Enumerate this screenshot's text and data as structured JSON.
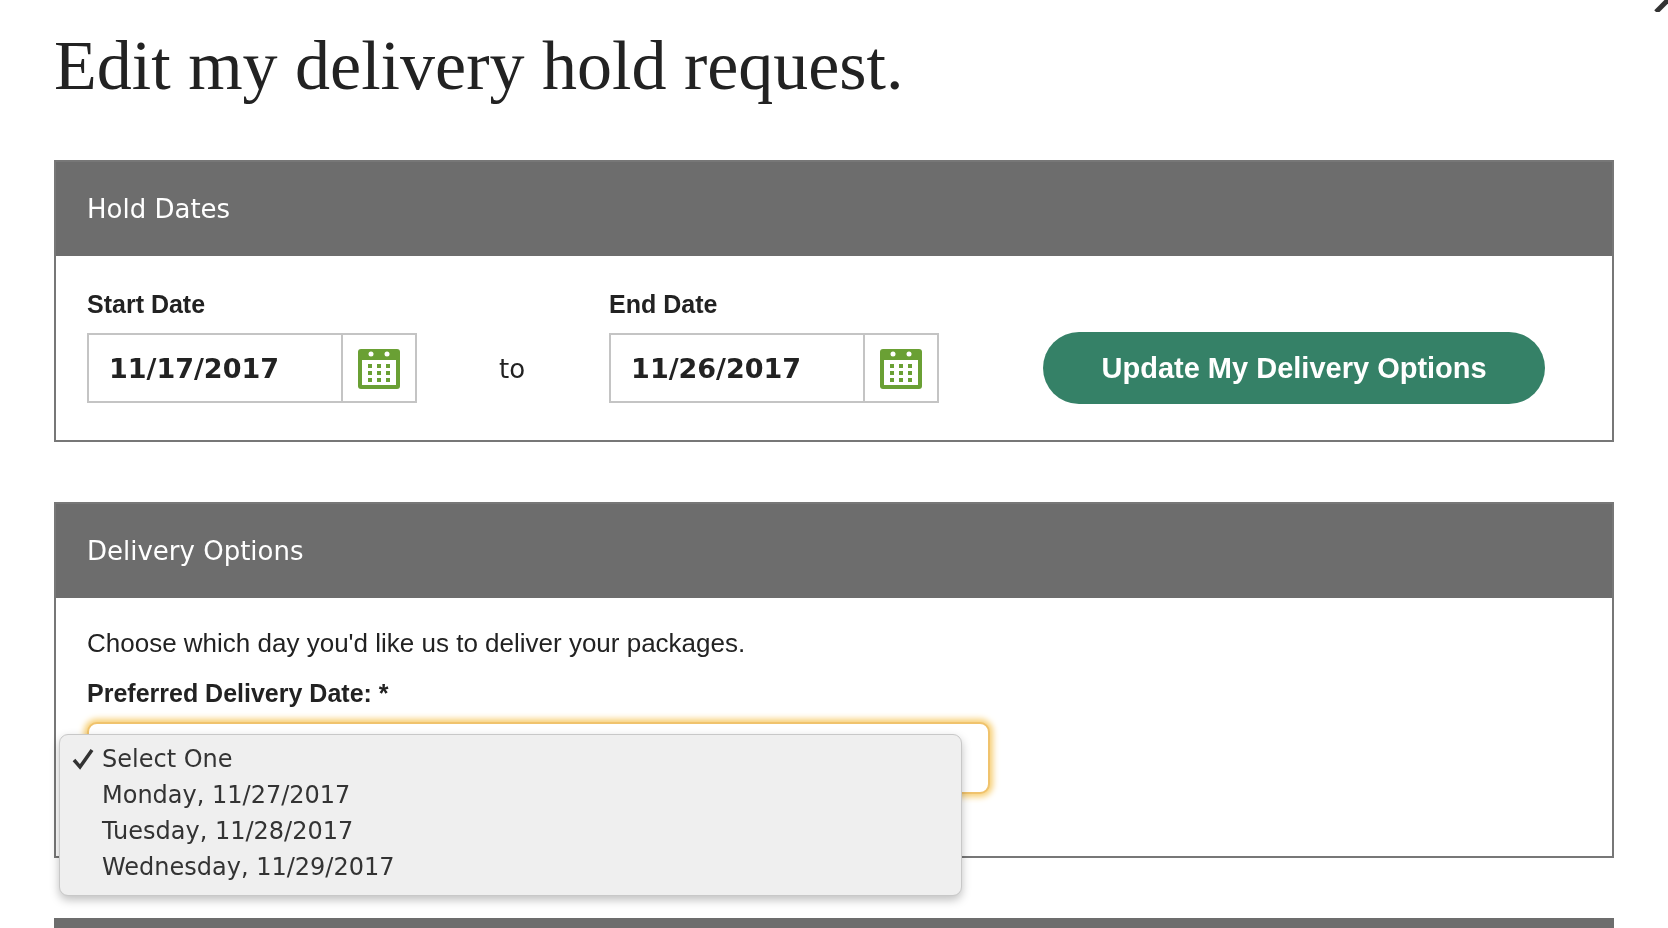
{
  "title": "Edit my delivery hold request.",
  "hold_dates": {
    "heading": "Hold Dates",
    "start": {
      "label": "Start Date",
      "value": "11/17/2017"
    },
    "separator": "to",
    "end": {
      "label": "End Date",
      "value": "11/26/2017"
    },
    "button": "Update My Delivery Options"
  },
  "delivery_options": {
    "heading": "Delivery Options",
    "intro": "Choose which day you'd like us to deliver your packages.",
    "field_label": "Preferred Delivery Date: *",
    "options": [
      {
        "label": "Select One",
        "selected": true
      },
      {
        "label": "Monday, 11/27/2017",
        "selected": false
      },
      {
        "label": "Tuesday, 11/28/2017",
        "selected": false
      },
      {
        "label": "Wednesday, 11/29/2017",
        "selected": false
      }
    ]
  }
}
